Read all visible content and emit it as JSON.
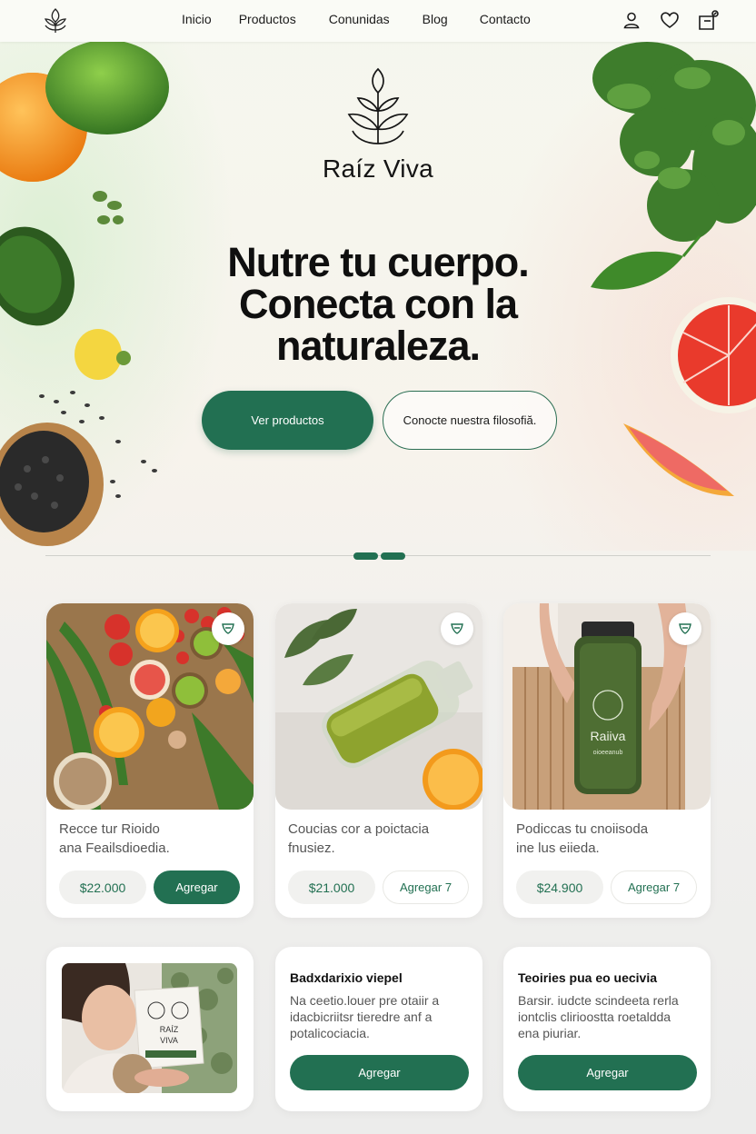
{
  "nav": {
    "links": [
      "Inicio",
      "Productos",
      "Conunidas",
      "Blog",
      "Contacto"
    ],
    "icons": [
      "user-icon",
      "heart-icon",
      "cart-icon"
    ]
  },
  "hero": {
    "brand": "Raíz Viva",
    "headline_lines": [
      "Nutre tu cuerpo.",
      "Conecta con la",
      "naturaleza."
    ],
    "primary_cta": "Ver productos",
    "secondary_cta": "Conocte nuestra filosofiă."
  },
  "products": [
    {
      "desc_lines": [
        "Recce tur Rioido",
        "ana Feailsdioedia."
      ],
      "price": "$22.000",
      "add_label": "Agregar",
      "add_style": "solid"
    },
    {
      "desc_lines": [
        "Coucias cor a poictacia",
        "fnusiez."
      ],
      "price": "$21.000",
      "add_label": "Agregar 7",
      "add_style": "ghost"
    },
    {
      "desc_lines": [
        "Podiccas tu cnoiisoda",
        "ine lus eiieda."
      ],
      "price": "$24.900",
      "add_label": "Agregar 7",
      "add_style": "ghost"
    }
  ],
  "bottom_cards": [
    {
      "type": "image",
      "package_lines": [
        "RAÍZ",
        "VIVA"
      ]
    },
    {
      "title": "Badxdarixio viepel",
      "body_lines": [
        "Na ceetio.louer pre otaiir a",
        "idacbicriitsr tieredre anf a",
        "potalicociacia."
      ],
      "add_label": "Agregar"
    },
    {
      "title": "Teoiries pua eo uecivia",
      "body_lines": [
        "Barsir. iudcte scindeeta rerla",
        "iontclis clirioostta roetaldda",
        "ena piuriar."
      ],
      "add_label": "Agregar"
    }
  ],
  "jar_label": [
    "Raiiva",
    "oioeeanub"
  ],
  "colors": {
    "accent": "#227052",
    "price_bg": "#f1f1ef",
    "text_dark": "#141414"
  }
}
